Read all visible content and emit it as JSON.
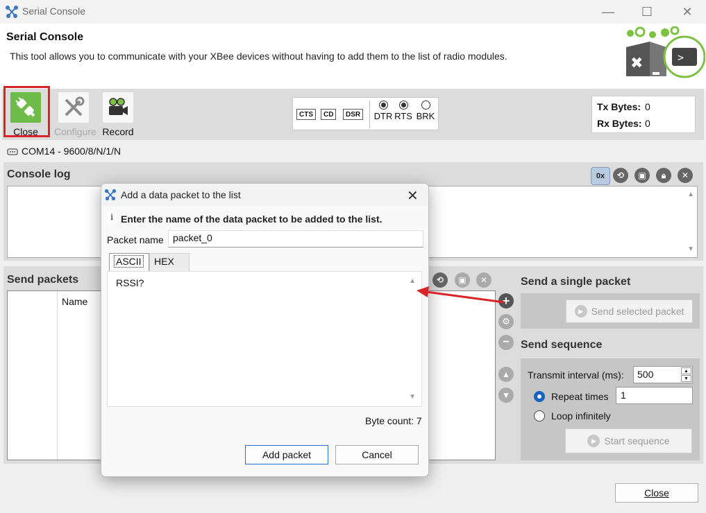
{
  "window": {
    "title": "Serial Console",
    "controls": {
      "minimize": "—",
      "maximize": "☐",
      "close": "✕"
    }
  },
  "header": {
    "title": "Serial Console",
    "description": "This tool allows you to communicate with your XBee devices without having to add them to the list of radio modules."
  },
  "toolbar": {
    "close_label": "Close",
    "configure_label": "Configure",
    "record_label": "Record",
    "signals": [
      "CTS",
      "CD",
      "DSR"
    ],
    "toggles": [
      {
        "label": "DTR",
        "checked": true
      },
      {
        "label": "RTS",
        "checked": true
      },
      {
        "label": "BRK",
        "checked": false
      }
    ],
    "tx_label": "Tx Bytes:",
    "tx_value": "0",
    "rx_label": "Rx Bytes:",
    "rx_value": "0",
    "highlight_color": "#d9252a"
  },
  "port": {
    "text": "COM14 - 9600/8/N/1/N"
  },
  "console_log": {
    "title": "Console log",
    "hex_button": "0x"
  },
  "send_packets": {
    "title": "Send packets",
    "name_header": "Name"
  },
  "single_packet": {
    "title": "Send a single packet",
    "button": "Send selected packet"
  },
  "sequence": {
    "title": "Send sequence",
    "interval_label": "Transmit interval (ms):",
    "interval_value": "500",
    "repeat_label": "Repeat times",
    "repeat_value": "1",
    "repeat_selected": true,
    "loop_label": "Loop infinitely",
    "start_button": "Start sequence"
  },
  "footer": {
    "close_label": "Close"
  },
  "dialog": {
    "title": "Add a data packet to the list",
    "info_icon": "i",
    "info_text": "Enter the name of the data packet to be added to the list.",
    "packet_name_label": "Packet name",
    "packet_name_value": "packet_0",
    "tabs": [
      "ASCII",
      "HEX"
    ],
    "data": "RSSI?",
    "byte_count": "Byte count: 7",
    "add_button": "Add packet",
    "cancel_button": "Cancel",
    "close_glyph": "✕"
  },
  "accent_color": "#1565c0",
  "annotation_color": "#d9252a"
}
